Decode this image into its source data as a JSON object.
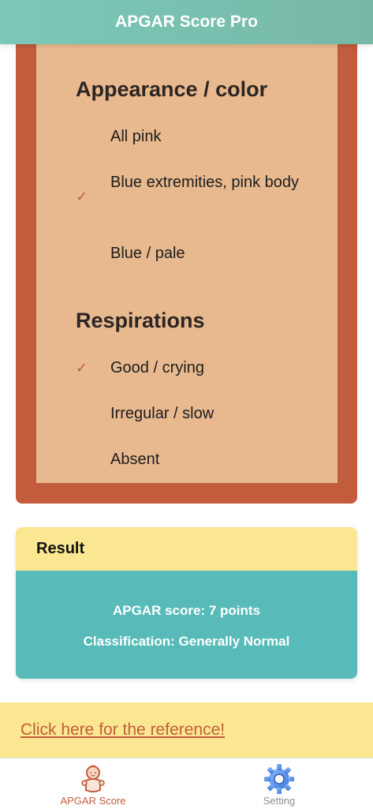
{
  "header": {
    "title": "APGAR Score Pro"
  },
  "sections": [
    {
      "title": "Appearance / color",
      "options": [
        {
          "label": "All pink",
          "selected": false
        },
        {
          "label": "Blue extremities, pink body",
          "selected": true
        },
        {
          "label": "Blue / pale",
          "selected": false
        }
      ]
    },
    {
      "title": "Respirations",
      "options": [
        {
          "label": "Good / crying",
          "selected": true
        },
        {
          "label": "Irregular / slow",
          "selected": false
        },
        {
          "label": "Absent",
          "selected": false
        }
      ]
    }
  ],
  "check_glyph": "✓",
  "result": {
    "title": "Result",
    "score_text": "APGAR score: 7 points",
    "classification_text": "Classification: Generally Normal"
  },
  "reference": {
    "link_text": "Click here for the reference!"
  },
  "tabbar": {
    "tabs": [
      {
        "label": "APGAR Score",
        "icon": "baby-icon",
        "active": true
      },
      {
        "label": "Setting",
        "icon": "gear-icon",
        "active": false
      }
    ]
  },
  "colors": {
    "header": "#7bc8b8",
    "card_border": "#c25c3d",
    "card_fill": "#e8b98f",
    "result_head": "#fbe791",
    "result_body": "#58bbb9",
    "active_tab": "#c25c3d",
    "inactive_tab": "#8e8e93"
  }
}
